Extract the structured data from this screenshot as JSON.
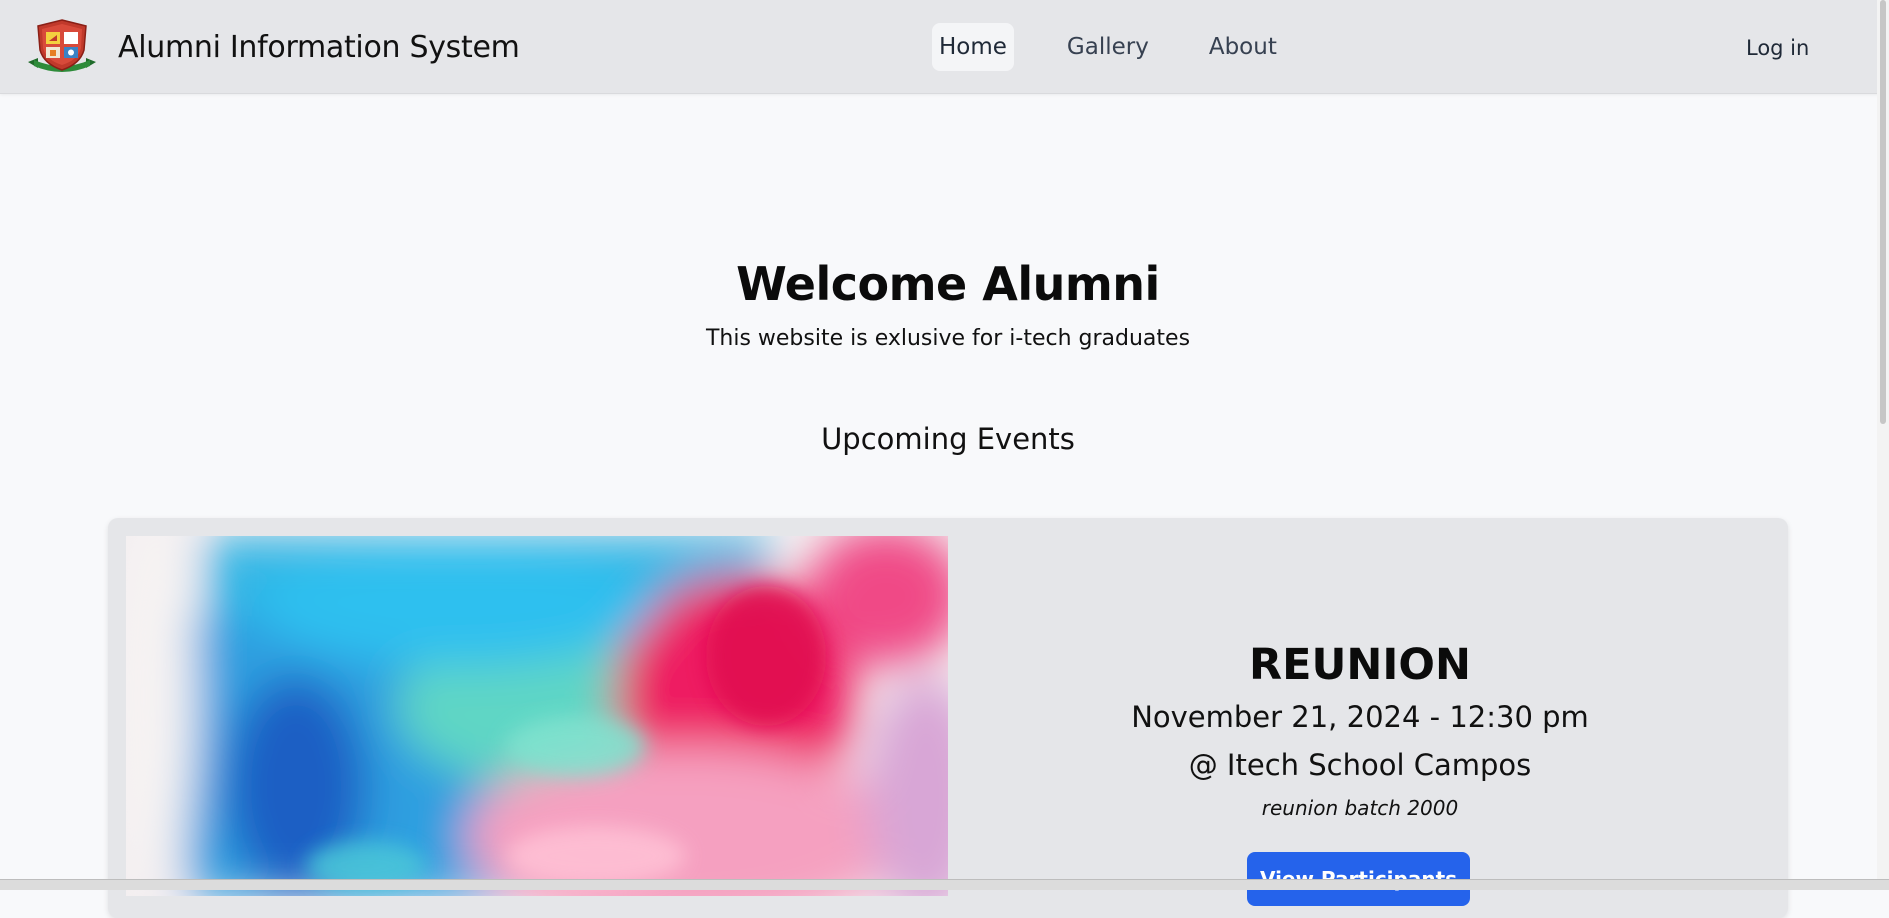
{
  "header": {
    "brand": "Alumni Information System",
    "nav": [
      {
        "label": "Home",
        "active": true
      },
      {
        "label": "Gallery",
        "active": false
      },
      {
        "label": "About",
        "active": false
      }
    ],
    "login_label": "Log in"
  },
  "hero": {
    "title": "Welcome Alumni",
    "subtitle": "This website is exlusive for i-tech graduates"
  },
  "events": {
    "heading": "Upcoming Events",
    "items": [
      {
        "title": "REUNION",
        "datetime": "November 21, 2024 - 12:30 pm",
        "venue": "@ Itech School Campos",
        "description": "reunion batch 2000",
        "button_label": "View Participants"
      }
    ]
  },
  "colors": {
    "header_bg": "#e5e6e9",
    "page_bg": "#f8f9fb",
    "card_bg": "#e5e6e9",
    "accent": "#2563eb"
  }
}
